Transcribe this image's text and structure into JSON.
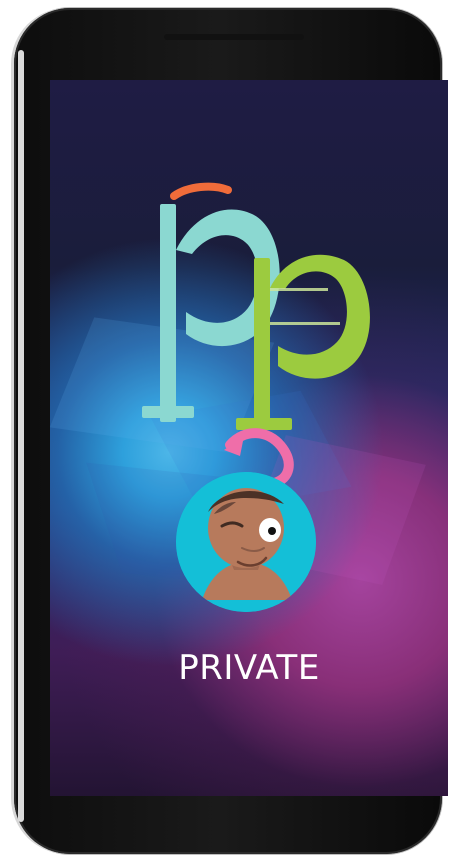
{
  "screen": {
    "label": "PRIVATE"
  },
  "icons": {
    "logo": "pp-logo",
    "avatar": "avatar-icon"
  },
  "colors": {
    "teal_letter": "#81d7d3",
    "green_letter": "#96c93d",
    "orange_arc": "#f06c3a",
    "pink_arc": "#ef6ea9",
    "avatar_bg": "#14bfd7"
  }
}
